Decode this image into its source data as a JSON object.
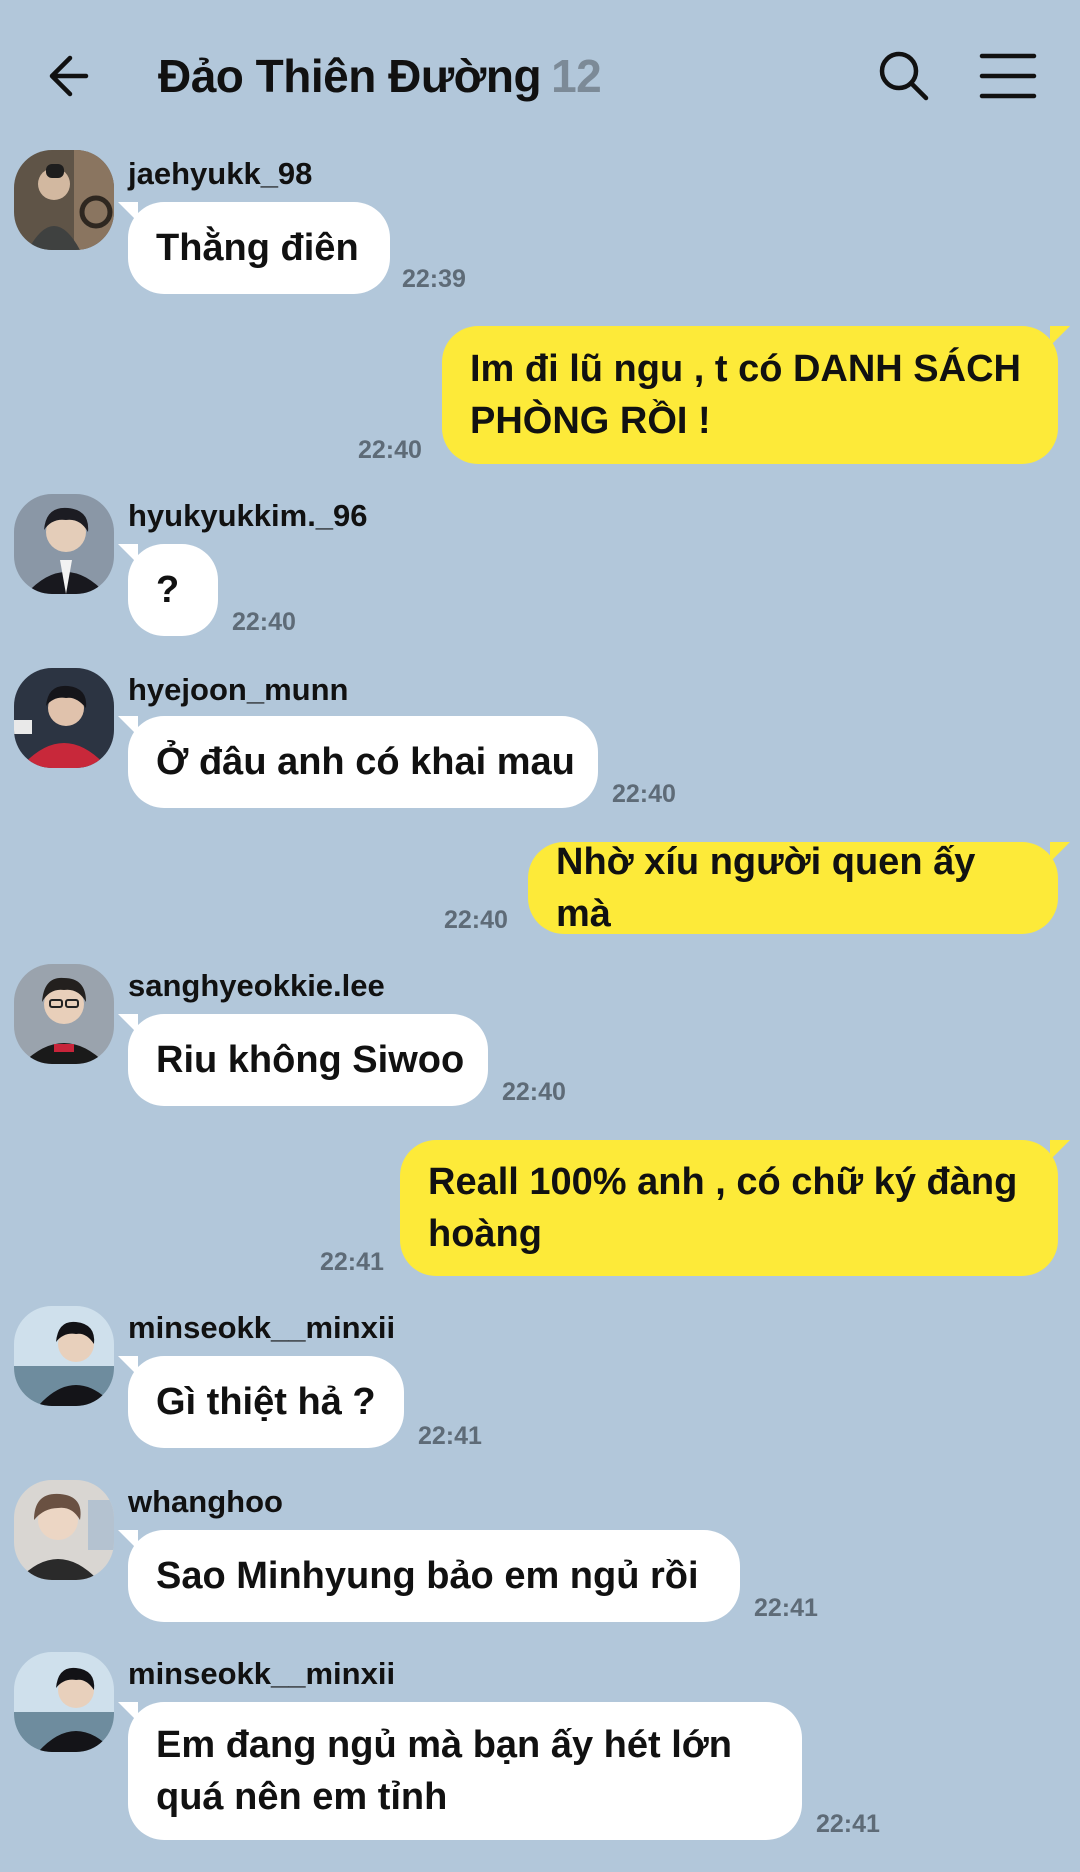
{
  "header": {
    "title": "Đảo Thiên Đường",
    "member_count": "12"
  },
  "messages": [
    {
      "sender": "jaehyukk_98",
      "text": "Thằng điên",
      "time": "22:39"
    },
    {
      "text": "Im đi lũ ngu , t có DANH SÁCH PHÒNG RỒI !",
      "time": "22:40"
    },
    {
      "sender": "hyukyukkim._96",
      "text": "?",
      "time": "22:40"
    },
    {
      "sender": "hyejoon_munn",
      "text": "Ở đâu anh có khai mau",
      "time": "22:40"
    },
    {
      "text": "Nhờ xíu người quen ấy mà",
      "time": "22:40"
    },
    {
      "sender": "sanghyeokkie.lee",
      "text": "Riu không Siwoo",
      "time": "22:40"
    },
    {
      "text": "Reall 100% anh , có chữ ký đàng hoàng",
      "time": "22:41"
    },
    {
      "sender": "minseokk__minxii",
      "text": "Gì thiệt hả ?",
      "time": "22:41"
    },
    {
      "sender": "whanghoo",
      "text": "Sao Minhyung bảo em ngủ rồi",
      "time": "22:41"
    },
    {
      "sender": "minseokk__minxii",
      "text": "Em đang ngủ mà bạn ấy hét lớn quá nên em tỉnh",
      "time": "22:41"
    }
  ],
  "colors": {
    "background": "#b2c7da",
    "incoming_bubble": "#ffffff",
    "outgoing_bubble": "#fdea39",
    "timestamp": "#5e6b77",
    "member_count": "#7c8a97"
  },
  "icons": [
    "back-arrow-icon",
    "search-icon",
    "menu-icon",
    "profile-photo"
  ]
}
